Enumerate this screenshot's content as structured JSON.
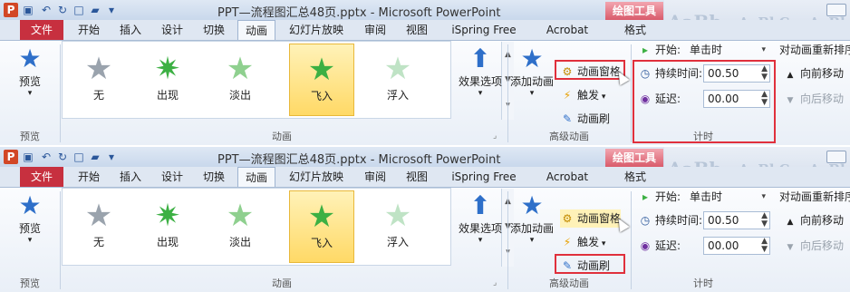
{
  "window": {
    "title": "PPT—流程图汇总48页.pptx - Microsoft PowerPoint",
    "app_icon_letter": "P",
    "tools_label": "绘图工具",
    "wordart_samples": [
      "AaBb",
      "AaBbC",
      "AaBl"
    ]
  },
  "tabs": [
    "文件",
    "开始",
    "插入",
    "设计",
    "切换",
    "动画",
    "幻灯片放映",
    "审阅",
    "视图",
    "iSpring Free",
    "Acrobat",
    "格式"
  ],
  "active_tab": "动画",
  "preview_group": {
    "button_label": "预览",
    "group_label": "预览"
  },
  "animation_group": {
    "group_label": "动画",
    "items": [
      "无",
      "出现",
      "淡出",
      "飞入",
      "浮入"
    ],
    "selected": "飞入",
    "effect_options_label": "效果选项"
  },
  "advanced_group": {
    "group_label": "高级动画",
    "add_animation_label": "添加动画",
    "animation_pane_label": "动画窗格",
    "trigger_label": "触发",
    "painter_label": "动画刷"
  },
  "timing_group": {
    "group_label": "计时",
    "start_label": "开始:",
    "start_value": "单击时",
    "duration_label": "持续时间:",
    "duration_value": "00.50",
    "delay_label": "延迟:",
    "delay_value": "00.00",
    "reorder_label": "对动画重新排序",
    "move_earlier_label": "向前移动",
    "move_later_label": "向后移动"
  },
  "colors": {
    "file_tab": "#c7303f",
    "highlight": "#e0303c",
    "selected_item": "#ffd966",
    "tools_label": "#d95b6b"
  }
}
